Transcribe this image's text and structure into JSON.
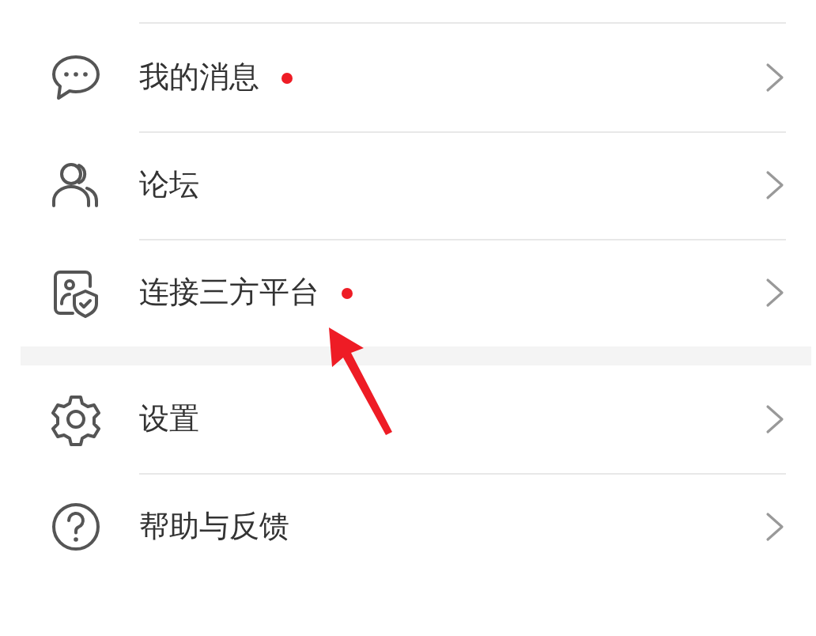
{
  "menu_groups": [
    {
      "items": [
        {
          "label": "我的消息",
          "dot": true
        },
        {
          "label": "论坛",
          "dot": false
        },
        {
          "label": "连接三方平台",
          "dot": true
        }
      ]
    },
    {
      "items": [
        {
          "label": "设置",
          "dot": false
        },
        {
          "label": "帮助与反馈",
          "dot": false
        }
      ]
    }
  ],
  "annotation": {
    "kind": "arrow"
  }
}
